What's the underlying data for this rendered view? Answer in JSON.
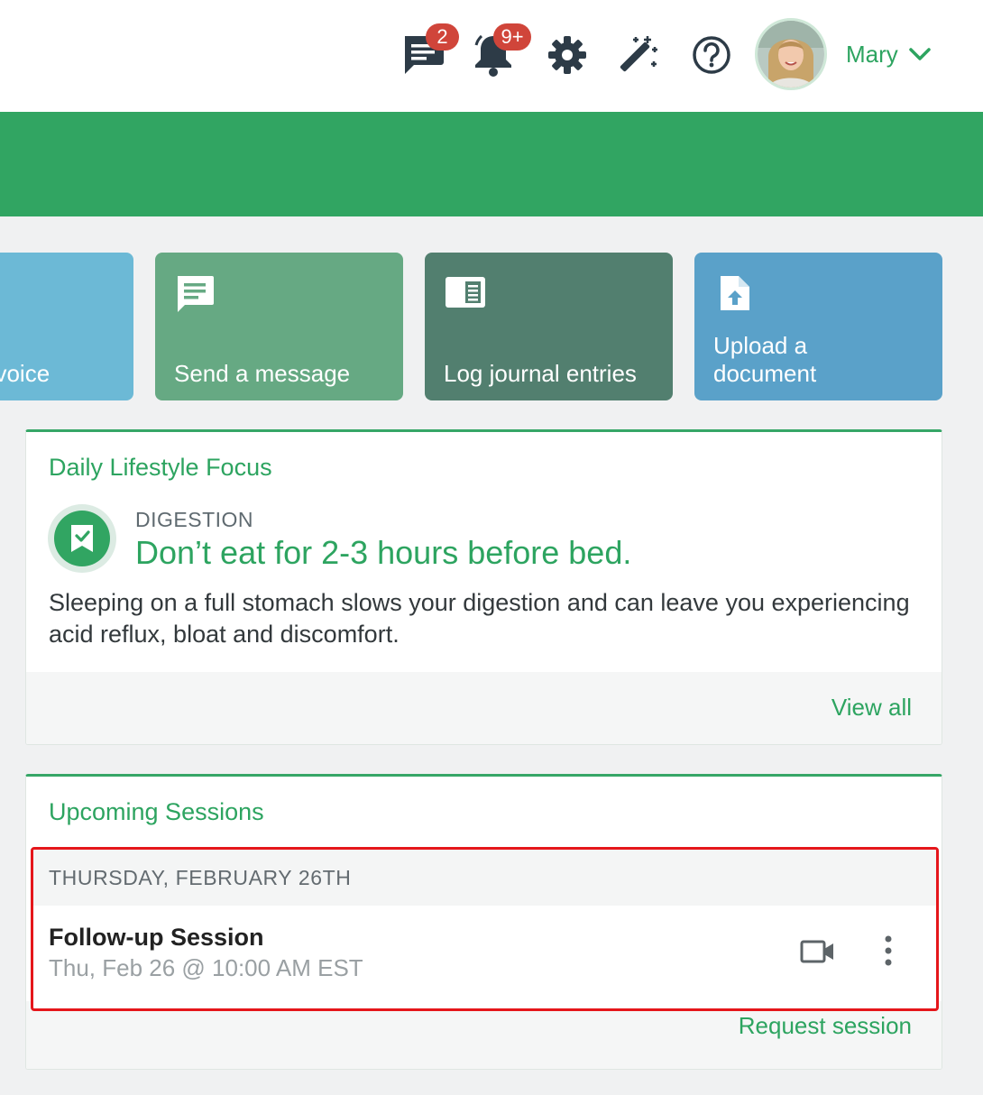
{
  "header": {
    "messages_badge": "2",
    "notifications_badge": "9+",
    "user_name": "Mary",
    "icons": [
      "chat-icon",
      "bell-icon",
      "gear-icon",
      "magic-wand-icon",
      "help-icon",
      "chevron-down-icon"
    ]
  },
  "tiles": [
    {
      "label": "nvoice",
      "color": "#6cb9d6"
    },
    {
      "label": "Send a message",
      "icon": "message-icon",
      "color": "#66a983"
    },
    {
      "label": "Log journal entries",
      "icon": "journal-icon",
      "color": "#527f6f"
    },
    {
      "label": "Upload a document",
      "icon": "upload-document-icon",
      "color": "#5aa1c9"
    }
  ],
  "lifestyle": {
    "title": "Daily Lifestyle Focus",
    "category": "DIGESTION",
    "headline": "Don’t eat for 2-3 hours before bed.",
    "body": "Sleeping on a full stomach slows your digestion and can leave you experiencing acid reflux, bloat and discomfort.",
    "view_all": "View all"
  },
  "sessions": {
    "title": "Upcoming Sessions",
    "date_heading": "THURSDAY, FEBRUARY 26TH",
    "item": {
      "name": "Follow-up Session",
      "time": "Thu, Feb 26 @ 10:00 AM EST"
    },
    "request": "Request session"
  },
  "colors": {
    "brand_green": "#31a562",
    "link_green": "#2da460",
    "badge_red": "#d0453a",
    "highlight_red": "#e5161b"
  }
}
